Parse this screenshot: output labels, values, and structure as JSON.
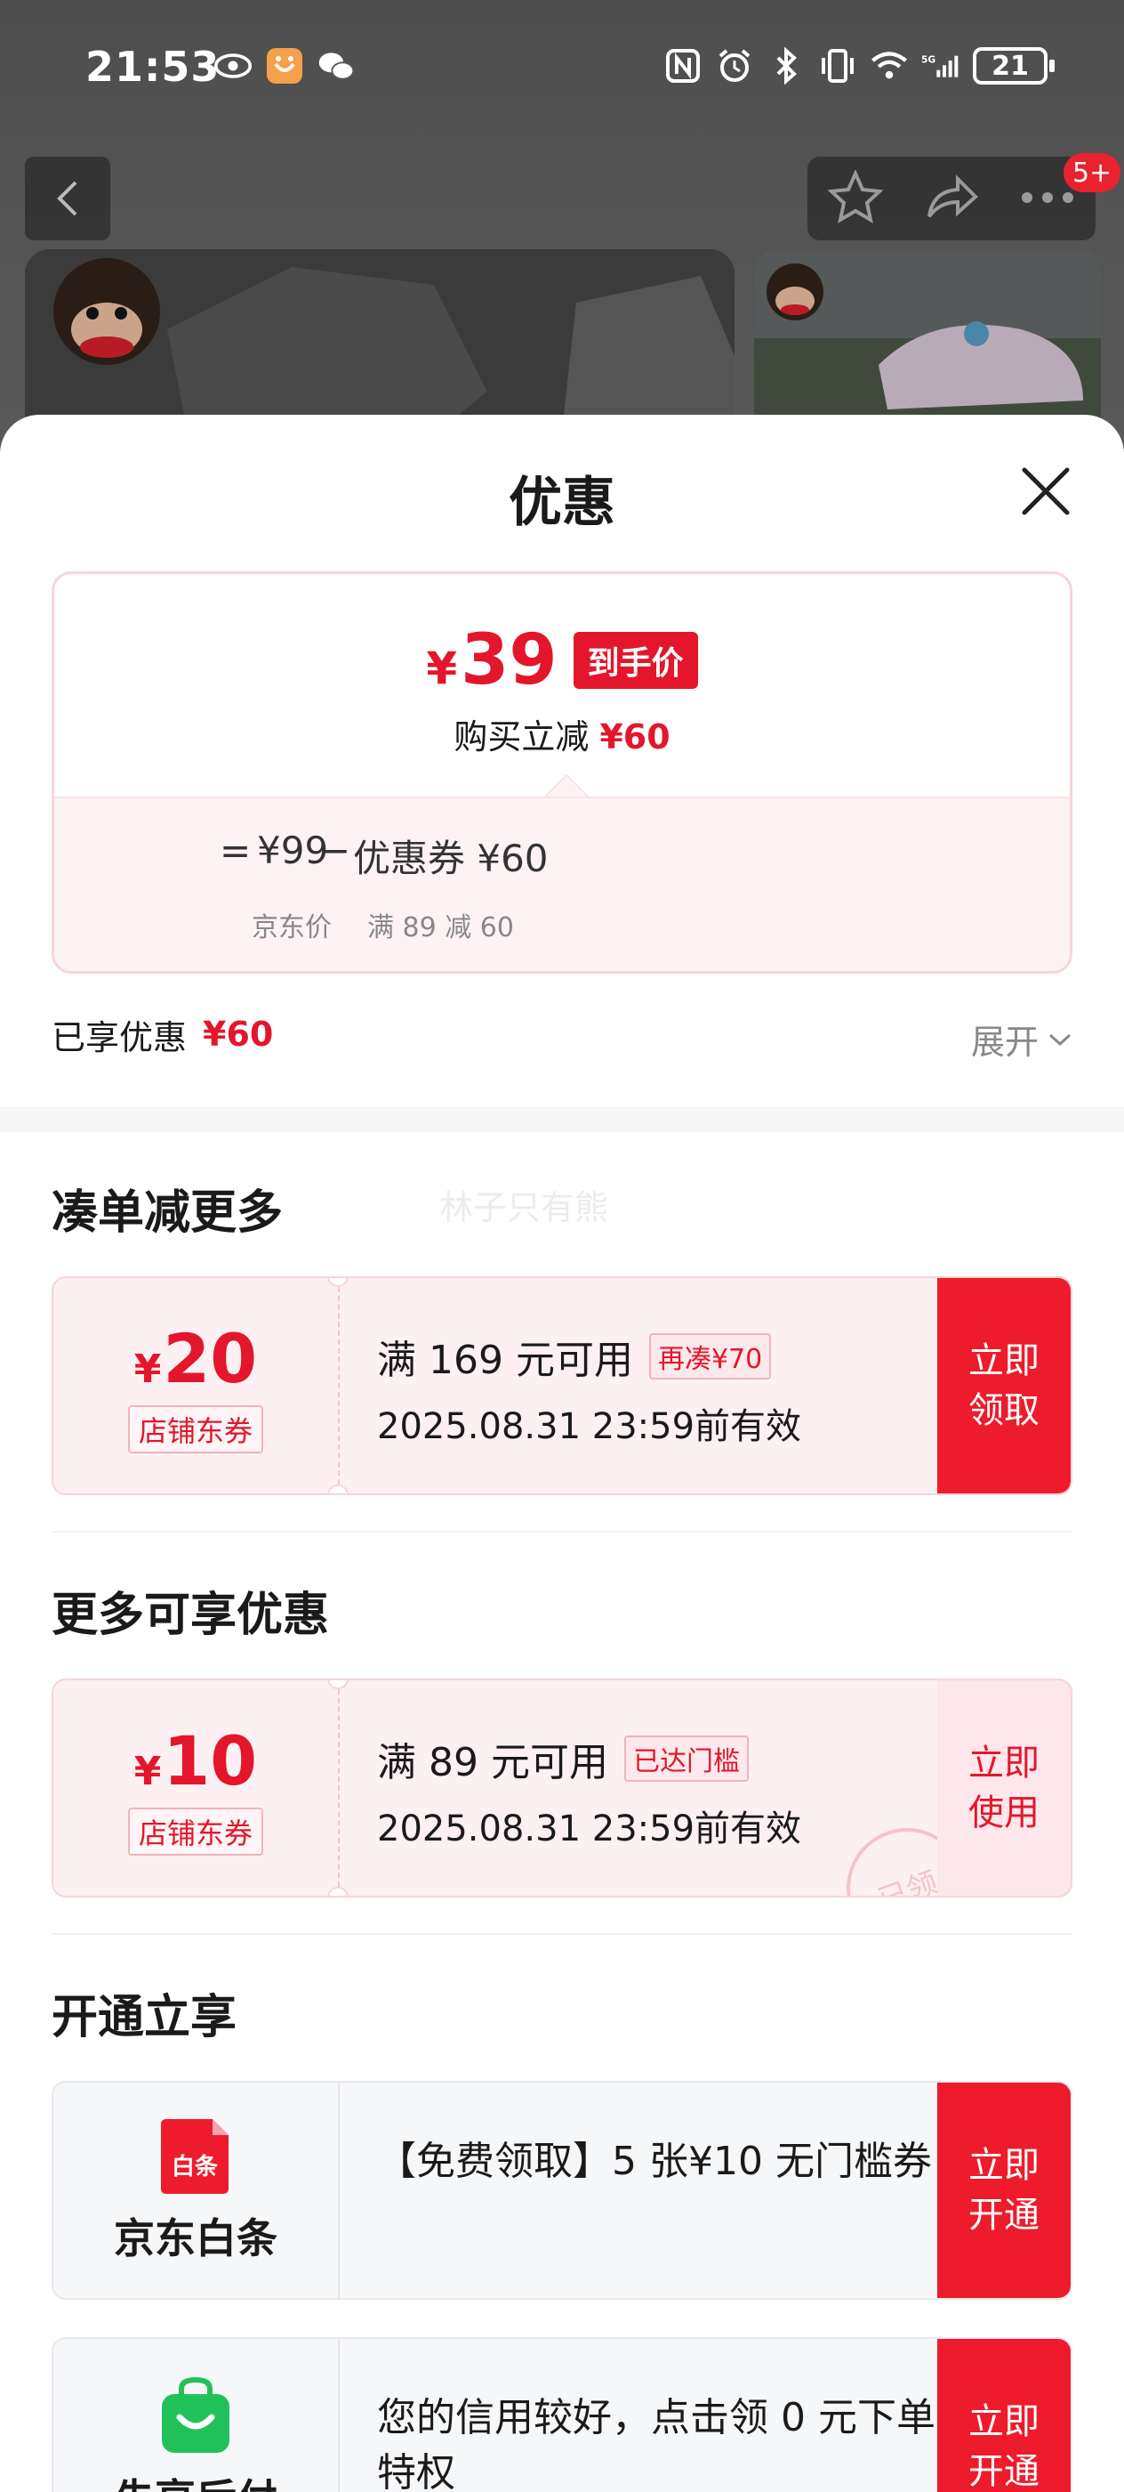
{
  "status_bar": {
    "time": "21:53",
    "battery": "21",
    "left_icons": [
      "eye-icon",
      "app-notification-icon",
      "wechat-icon"
    ],
    "right_icons": [
      "nfc-icon",
      "alarm-icon",
      "bluetooth-icon",
      "vibrate-icon",
      "wifi-icon",
      "signal-5g-icon"
    ]
  },
  "nav": {
    "badge": "5+"
  },
  "sheet": {
    "title": "优惠",
    "price_card": {
      "currency": "¥",
      "final_price": "39",
      "final_tag": "到手价",
      "reduce_label": "购买立减",
      "reduce_amount": "¥60",
      "eq": "=",
      "base_price": "¥99",
      "minus": "−",
      "coupon_label": "优惠券 ¥60",
      "base_label": "京东价",
      "coupon_rule": "满 89 减 60"
    },
    "enjoyed": {
      "label": "已享优惠",
      "amount": "¥60",
      "expand": "展开"
    },
    "watermark": "林子只有熊",
    "sections": {
      "more_combo": "凑单减更多",
      "more_available": "更多可享优惠",
      "open_enjoy": "开通立享"
    },
    "coupons": [
      {
        "currency": "¥",
        "amount": "20",
        "type": "店铺东券",
        "condition": "满 169 元可用",
        "tag": "再凑¥70",
        "validity": "2025.08.31 23:59前有效",
        "action": "立即领取"
      },
      {
        "currency": "¥",
        "amount": "10",
        "type": "店铺东券",
        "condition": "满 89 元可用",
        "tag": "已达门槛",
        "validity": "2025.08.31 23:59前有效",
        "action": "立即使用",
        "stamp": "已领"
      }
    ],
    "services": [
      {
        "name": "京东白条",
        "icon_text": "白条",
        "desc": "【免费领取】5 张¥10 无门槛券",
        "action": "立即开通",
        "color": "#ee1b2d"
      },
      {
        "name": "先享后付",
        "desc": "您的信用较好，点击领 0 元下单特权",
        "action": "立即开通",
        "color": "#21c15a"
      }
    ]
  },
  "colors": {
    "accent": "#e3162b",
    "button": "#ee1b2d",
    "backdrop": "#4e4e4e"
  }
}
